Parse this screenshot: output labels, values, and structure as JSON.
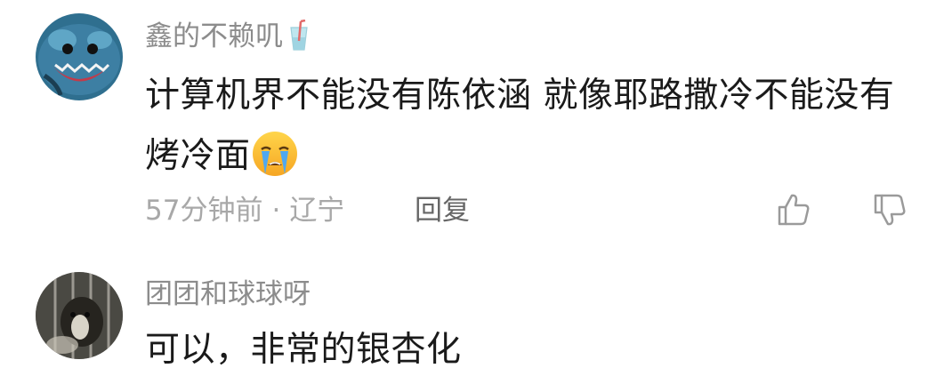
{
  "comments": [
    {
      "username": "鑫的不赖叽",
      "badge_icon": "cup-badge-icon",
      "text": "计算机界不能没有陈依涵 就像耶路撒冷不能没有烤冷面",
      "emoji": "crying-face-emoji",
      "time": "57分钟前",
      "separator": "·",
      "location": "辽宁",
      "reply_label": "回复"
    },
    {
      "username": "团团和球球呀",
      "text": "可以，非常的银杏化"
    }
  ],
  "icons": {
    "like": "thumbs-up-icon",
    "dislike": "thumbs-down-icon"
  },
  "colors": {
    "username": "#8c8c8c",
    "text": "#1a1a1a",
    "meta": "#a8a8a8",
    "reply": "#666666"
  }
}
